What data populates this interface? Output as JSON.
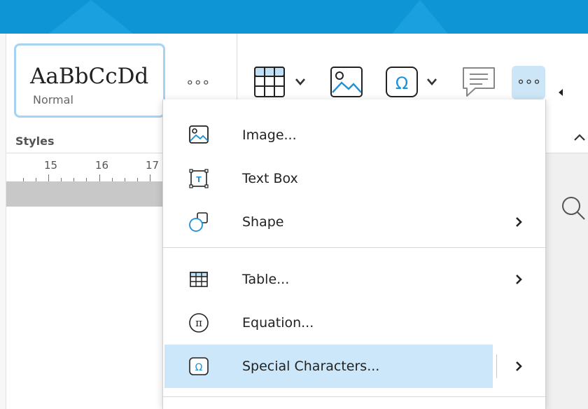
{
  "styles_panel": {
    "sample_text": "AaBbCcDd",
    "style_name": "Normal",
    "more_label": "∘∘∘",
    "section_label": "Styles"
  },
  "ruler": {
    "marks": [
      "15",
      "16",
      "17"
    ]
  },
  "toolbar": {
    "table_icon": "table-icon",
    "image_icon": "image-icon",
    "special_char_icon": "omega-icon",
    "comment_icon": "comment-icon",
    "more_label": "∘∘∘",
    "accent_color": "#0e95d6",
    "active_bg": "#cce6f8"
  },
  "insert_menu": {
    "items": [
      {
        "label": "Image...",
        "icon": "image-icon",
        "has_submenu": false
      },
      {
        "label": "Text Box",
        "icon": "text-box-icon",
        "has_submenu": false
      },
      {
        "label": "Shape",
        "icon": "shape-icon",
        "has_submenu": true
      },
      {
        "label": "Table...",
        "icon": "table-icon",
        "has_submenu": true
      },
      {
        "label": "Equation...",
        "icon": "pi-icon",
        "has_submenu": false
      },
      {
        "label": "Special Characters...",
        "icon": "omega-icon",
        "has_submenu": true,
        "highlighted": true
      }
    ]
  }
}
